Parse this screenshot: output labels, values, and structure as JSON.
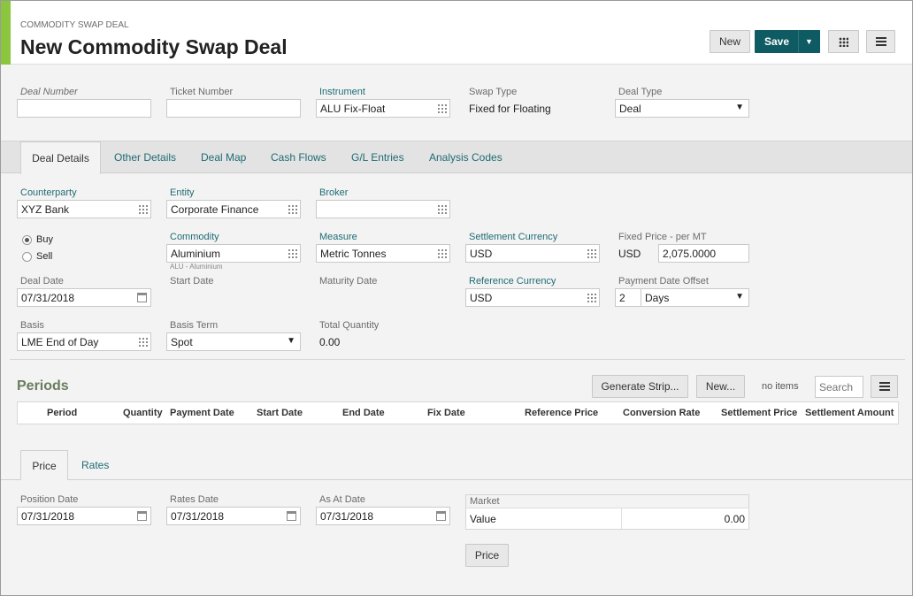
{
  "header": {
    "eyebrow": "COMMODITY SWAP DEAL",
    "title": "New Commodity Swap Deal",
    "new_label": "New",
    "save_label": "Save",
    "accent_color": "#8cc63e",
    "primary_color": "#0f5b63"
  },
  "deal_header": {
    "deal_number_label": "Deal Number",
    "deal_number_value": "",
    "ticket_number_label": "Ticket Number",
    "ticket_number_value": "",
    "instrument_label": "Instrument",
    "instrument_value": "ALU Fix-Float",
    "swap_type_label": "Swap Type",
    "swap_type_value": "Fixed for Floating",
    "deal_type_label": "Deal Type",
    "deal_type_value": "Deal"
  },
  "tabs": [
    {
      "label": "Deal Details",
      "active": true
    },
    {
      "label": "Other Details"
    },
    {
      "label": "Deal Map"
    },
    {
      "label": "Cash Flows"
    },
    {
      "label": "G/L Entries"
    },
    {
      "label": "Analysis Codes"
    }
  ],
  "details": {
    "counterparty_label": "Counterparty",
    "counterparty_value": "XYZ Bank",
    "entity_label": "Entity",
    "entity_value": "Corporate Finance",
    "broker_label": "Broker",
    "broker_value": "",
    "buy_label": "Buy",
    "sell_label": "Sell",
    "direction_selected": "Buy",
    "commodity_label": "Commodity",
    "commodity_value": "Aluminium",
    "commodity_hint": "ALU - Aluminium",
    "measure_label": "Measure",
    "measure_value": "Metric Tonnes",
    "settlement_currency_label": "Settlement Currency",
    "settlement_currency_value": "USD",
    "fixed_price_label": "Fixed Price - per MT",
    "fixed_price_currency": "USD",
    "fixed_price_value": "2,075.0000",
    "deal_date_label": "Deal Date",
    "deal_date_value": "07/31/2018",
    "start_date_label": "Start Date",
    "maturity_date_label": "Maturity Date",
    "reference_currency_label": "Reference Currency",
    "reference_currency_value": "USD",
    "payment_offset_label": "Payment Date Offset",
    "payment_offset_value": "2",
    "payment_offset_unit": "Days",
    "basis_label": "Basis",
    "basis_value": "LME End of Day",
    "basis_term_label": "Basis Term",
    "basis_term_value": "Spot",
    "total_quantity_label": "Total Quantity",
    "total_quantity_value": "0.00"
  },
  "periods": {
    "title": "Periods",
    "generate_label": "Generate Strip...",
    "new_label": "New...",
    "items_text": "no items",
    "search_placeholder": "Search",
    "columns": [
      "Period",
      "Quantity",
      "Payment Date",
      "Start Date",
      "End Date",
      "Fix Date",
      "Reference Price",
      "Conversion Rate",
      "Settlement Price",
      "Settlement Amount"
    ]
  },
  "price_tabs": [
    {
      "label": "Price",
      "active": true
    },
    {
      "label": "Rates"
    }
  ],
  "price": {
    "position_date_label": "Position Date",
    "position_date_value": "07/31/2018",
    "rates_date_label": "Rates Date",
    "rates_date_value": "07/31/2018",
    "as_at_date_label": "As At Date",
    "as_at_date_value": "07/31/2018",
    "market_label": "Market",
    "market_row_label": "Value",
    "market_row_value": "0.00",
    "price_button_label": "Price"
  }
}
